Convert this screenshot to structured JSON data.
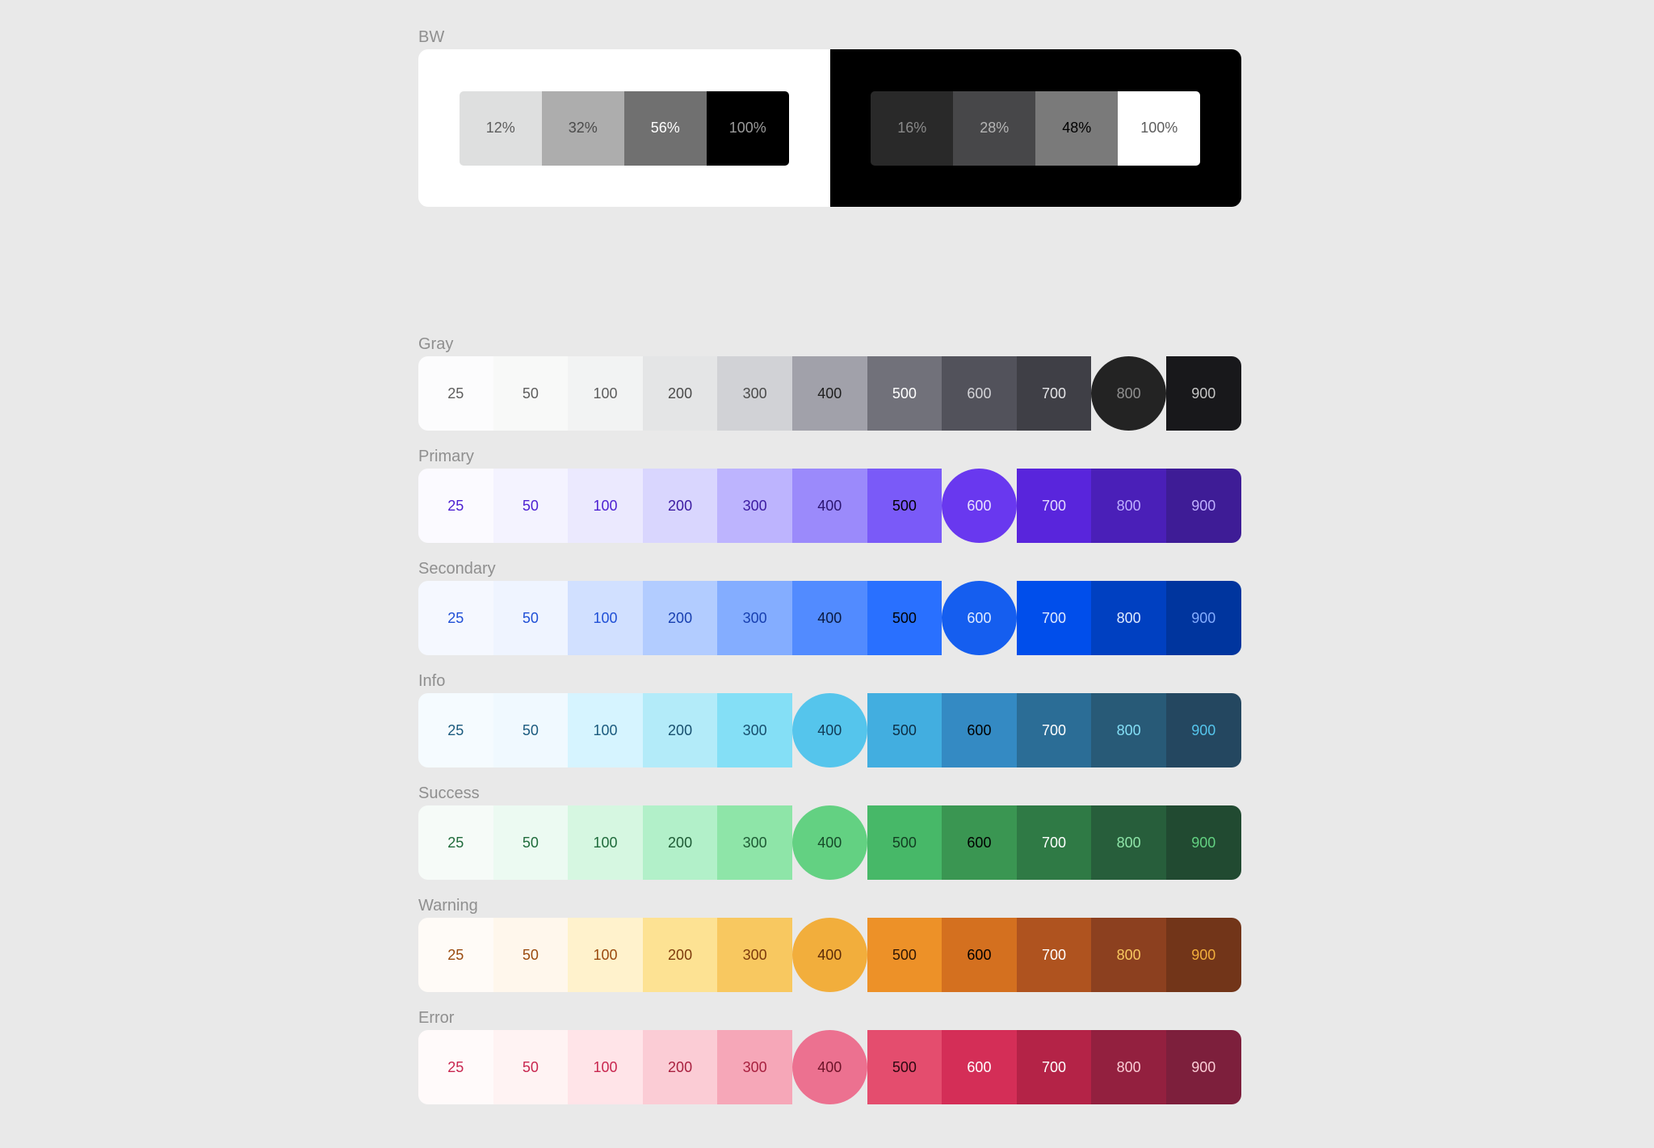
{
  "bw": {
    "label": "BW",
    "light": [
      {
        "text": "12%",
        "bg": "#dedfdf",
        "fg": "#5d5d5d"
      },
      {
        "text": "32%",
        "bg": "#adadad",
        "fg": "#4a4a4a"
      },
      {
        "text": "56%",
        "bg": "#707070",
        "fg": "#ffffff"
      },
      {
        "text": "100%",
        "bg": "#000000",
        "fg": "#9b9b9b"
      }
    ],
    "dark": [
      {
        "text": "16%",
        "bg": "#292929",
        "fg": "#8a8a8a"
      },
      {
        "text": "28%",
        "bg": "#474749",
        "fg": "#b5b5b5"
      },
      {
        "text": "48%",
        "bg": "#7a7a7a",
        "fg": "#000000"
      },
      {
        "text": "100%",
        "bg": "#ffffff",
        "fg": "#5d5d5d"
      }
    ]
  },
  "palettes": [
    {
      "name": "Gray",
      "circle_index": 9,
      "swatches": [
        {
          "text": "25",
          "bg": "#fcfcfd",
          "fg": "#5d5d5d"
        },
        {
          "text": "50",
          "bg": "#f8f9f8",
          "fg": "#5d5d5d"
        },
        {
          "text": "100",
          "bg": "#f2f3f3",
          "fg": "#5d5d5d"
        },
        {
          "text": "200",
          "bg": "#e4e5e6",
          "fg": "#4a4a4a"
        },
        {
          "text": "300",
          "bg": "#d1d2d6",
          "fg": "#4a4a4a"
        },
        {
          "text": "400",
          "bg": "#a1a1aa",
          "fg": "#1f1f1f"
        },
        {
          "text": "500",
          "bg": "#71717a",
          "fg": "#ffffff"
        },
        {
          "text": "600",
          "bg": "#52525b",
          "fg": "#d4d4d8"
        },
        {
          "text": "700",
          "bg": "#3f3f46",
          "fg": "#e4e4e7"
        },
        {
          "text": "800",
          "bg": "#232323",
          "fg": "#8f8f8f"
        },
        {
          "text": "900",
          "bg": "#18181b",
          "fg": "#c4c4c4"
        }
      ]
    },
    {
      "name": "Primary",
      "circle_index": 7,
      "swatches": [
        {
          "text": "25",
          "bg": "#fbfaff",
          "fg": "#4c1fd1"
        },
        {
          "text": "50",
          "bg": "#f4f3ff",
          "fg": "#4c1fd1"
        },
        {
          "text": "100",
          "bg": "#ebe9fe",
          "fg": "#4c1fd1"
        },
        {
          "text": "200",
          "bg": "#d9d6fe",
          "fg": "#3b1aa1"
        },
        {
          "text": "300",
          "bg": "#bdb4fe",
          "fg": "#3b1aa1"
        },
        {
          "text": "400",
          "bg": "#9b8afb",
          "fg": "#2a1470"
        },
        {
          "text": "500",
          "bg": "#7a5af8",
          "fg": "#000000"
        },
        {
          "text": "600",
          "bg": "#6938ef",
          "fg": "#e9e3ff"
        },
        {
          "text": "700",
          "bg": "#5925dc",
          "fg": "#e3dcff"
        },
        {
          "text": "800",
          "bg": "#4a1fb8",
          "fg": "#bfb0ff"
        },
        {
          "text": "900",
          "bg": "#3e1c96",
          "fg": "#bfb0ff"
        }
      ]
    },
    {
      "name": "Secondary",
      "circle_index": 7,
      "swatches": [
        {
          "text": "25",
          "bg": "#f5f8ff",
          "fg": "#1f4fd6"
        },
        {
          "text": "50",
          "bg": "#eff4ff",
          "fg": "#1f4fd6"
        },
        {
          "text": "100",
          "bg": "#d1e0ff",
          "fg": "#1f4fd6"
        },
        {
          "text": "200",
          "bg": "#b2ccff",
          "fg": "#173fb0"
        },
        {
          "text": "300",
          "bg": "#84adff",
          "fg": "#173fb0"
        },
        {
          "text": "400",
          "bg": "#528bff",
          "fg": "#0b1a40"
        },
        {
          "text": "500",
          "bg": "#2970ff",
          "fg": "#000000"
        },
        {
          "text": "600",
          "bg": "#155eef",
          "fg": "#e1ebff"
        },
        {
          "text": "700",
          "bg": "#004eeb",
          "fg": "#e1ebff"
        },
        {
          "text": "800",
          "bg": "#0040c1",
          "fg": "#e1ebff"
        },
        {
          "text": "900",
          "bg": "#00359e",
          "fg": "#84adff"
        }
      ]
    },
    {
      "name": "Info",
      "circle_index": 5,
      "swatches": [
        {
          "text": "25",
          "bg": "#f5fbff",
          "fg": "#1b5a7e"
        },
        {
          "text": "50",
          "bg": "#f0f9ff",
          "fg": "#1b5a7e"
        },
        {
          "text": "100",
          "bg": "#d6f4ff",
          "fg": "#1b5a7e"
        },
        {
          "text": "200",
          "bg": "#b3ebf9",
          "fg": "#174f6e"
        },
        {
          "text": "300",
          "bg": "#84dff6",
          "fg": "#174f6e"
        },
        {
          "text": "400",
          "bg": "#55c5ec",
          "fg": "#123c57"
        },
        {
          "text": "500",
          "bg": "#42aee0",
          "fg": "#0d2e45"
        },
        {
          "text": "600",
          "bg": "#348ac3",
          "fg": "#000000"
        },
        {
          "text": "700",
          "bg": "#2b6d96",
          "fg": "#ffffff"
        },
        {
          "text": "800",
          "bg": "#285a77",
          "fg": "#84dff6"
        },
        {
          "text": "900",
          "bg": "#244760",
          "fg": "#55c5ec"
        }
      ]
    },
    {
      "name": "Success",
      "circle_index": 5,
      "swatches": [
        {
          "text": "25",
          "bg": "#f6fbf8",
          "fg": "#1f6b3b"
        },
        {
          "text": "50",
          "bg": "#ecfaf2",
          "fg": "#1f6b3b"
        },
        {
          "text": "100",
          "bg": "#d6f7e1",
          "fg": "#1f6b3b"
        },
        {
          "text": "200",
          "bg": "#b2f0c9",
          "fg": "#1d5a34"
        },
        {
          "text": "300",
          "bg": "#8ee5a8",
          "fg": "#1d5a34"
        },
        {
          "text": "400",
          "bg": "#63d182",
          "fg": "#164a29"
        },
        {
          "text": "500",
          "bg": "#47b868",
          "fg": "#123d22"
        },
        {
          "text": "600",
          "bg": "#3a9652",
          "fg": "#000000"
        },
        {
          "text": "700",
          "bg": "#2f7a45",
          "fg": "#ffffff"
        },
        {
          "text": "800",
          "bg": "#275e3b",
          "fg": "#8ee5a8"
        },
        {
          "text": "900",
          "bg": "#214a31",
          "fg": "#63d182"
        }
      ]
    },
    {
      "name": "Warning",
      "circle_index": 5,
      "swatches": [
        {
          "text": "25",
          "bg": "#fffbf7",
          "fg": "#9a4a0e"
        },
        {
          "text": "50",
          "bg": "#fff7ec",
          "fg": "#9a4a0e"
        },
        {
          "text": "100",
          "bg": "#fff2cc",
          "fg": "#9a4a0e"
        },
        {
          "text": "200",
          "bg": "#fde293",
          "fg": "#7d3a0c"
        },
        {
          "text": "300",
          "bg": "#f8c860",
          "fg": "#7d3a0c"
        },
        {
          "text": "400",
          "bg": "#f2ae3c",
          "fg": "#5c2b09"
        },
        {
          "text": "500",
          "bg": "#ed9128",
          "fg": "#2e1604"
        },
        {
          "text": "600",
          "bg": "#d4701f",
          "fg": "#000000"
        },
        {
          "text": "700",
          "bg": "#af531f",
          "fg": "#ffffff"
        },
        {
          "text": "800",
          "bg": "#8c401f",
          "fg": "#f8c860"
        },
        {
          "text": "900",
          "bg": "#723519",
          "fg": "#f2ae3c"
        }
      ]
    },
    {
      "name": "Error",
      "circle_index": 5,
      "swatches": [
        {
          "text": "25",
          "bg": "#fffafa",
          "fg": "#c8264f"
        },
        {
          "text": "50",
          "bg": "#fff3f3",
          "fg": "#c8264f"
        },
        {
          "text": "100",
          "bg": "#ffe4e8",
          "fg": "#c8264f"
        },
        {
          "text": "200",
          "bg": "#fbccd5",
          "fg": "#a8203f"
        },
        {
          "text": "300",
          "bg": "#f6a7b8",
          "fg": "#a8203f"
        },
        {
          "text": "400",
          "bg": "#ec7190",
          "fg": "#6d1328"
        },
        {
          "text": "500",
          "bg": "#e44d6e",
          "fg": "#2b0810"
        },
        {
          "text": "600",
          "bg": "#d42e57",
          "fg": "#ffffff"
        },
        {
          "text": "700",
          "bg": "#b42347",
          "fg": "#ffffff"
        },
        {
          "text": "800",
          "bg": "#93203f",
          "fg": "#fbccd5"
        },
        {
          "text": "900",
          "bg": "#7d1f3c",
          "fg": "#fbccd5"
        }
      ]
    }
  ]
}
